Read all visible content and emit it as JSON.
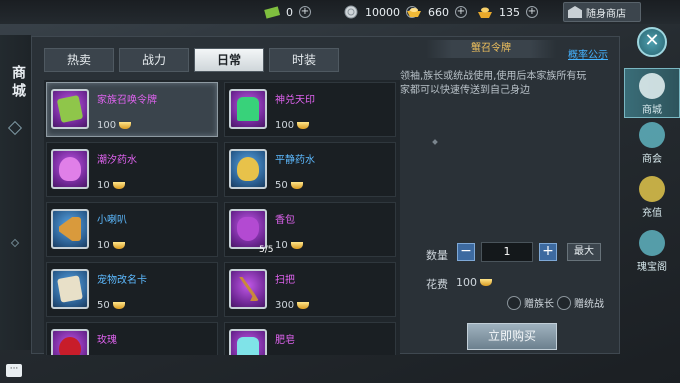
{
  "topbar": {
    "resources": [
      {
        "icon": "cash-icon",
        "value": "0"
      },
      {
        "icon": "silver-coin-icon",
        "value": "10000"
      },
      {
        "icon": "gold-ingot-icon",
        "value": "660"
      },
      {
        "icon": "bound-ingot-icon",
        "value": "135"
      }
    ],
    "shop_button": "随身商店"
  },
  "left_title": "商城",
  "tabs": [
    {
      "label": "热卖"
    },
    {
      "label": "战力"
    },
    {
      "label": "日常"
    },
    {
      "label": "时装"
    }
  ],
  "active_tab": "日常",
  "notice_link": "概率公示",
  "items": [
    {
      "name": "家族召唤令牌",
      "price": "100",
      "rarity": "purple",
      "icon": "summon-token-icon",
      "qty": "",
      "selected": true
    },
    {
      "name": "神兑天印",
      "price": "100",
      "rarity": "purple",
      "icon": "jade-seal-icon",
      "qty": ""
    },
    {
      "name": "潮汐药水",
      "price": "10",
      "rarity": "purple",
      "icon": "potion-bottle-icon",
      "qty": ""
    },
    {
      "name": "平静药水",
      "price": "50",
      "rarity": "blue",
      "icon": "potion-bottle-icon",
      "qty": ""
    },
    {
      "name": "小喇叭",
      "price": "10",
      "rarity": "blue",
      "icon": "horn-icon",
      "qty": ""
    },
    {
      "name": "香包",
      "price": "10",
      "rarity": "purple",
      "icon": "sachet-icon",
      "qty": "5/5"
    },
    {
      "name": "宠物改名卡",
      "price": "50",
      "rarity": "blue",
      "icon": "rename-card-icon",
      "qty": ""
    },
    {
      "name": "扫把",
      "price": "300",
      "rarity": "purple",
      "icon": "broom-icon",
      "qty": ""
    },
    {
      "name": "玫瑰",
      "price": "",
      "rarity": "purple",
      "icon": "rose-icon",
      "qty": ""
    },
    {
      "name": "肥皂",
      "price": "",
      "rarity": "purple",
      "icon": "soap-icon",
      "qty": ""
    }
  ],
  "detail": {
    "title": "蟹召令牌",
    "description": "领袖,族长或统战使用,使用后本家族所有玩家都可以快速传送到自己身边",
    "quantity_label": "数量",
    "quantity_value": "1",
    "max_label": "最大",
    "cost_label": "花费",
    "cost_value": "100",
    "gift_leader": "赠族长",
    "gift_commander": "赠统战",
    "buy_label": "立即购买"
  },
  "sidenav": [
    {
      "label": "商城",
      "icon": "shop-icon"
    },
    {
      "label": "商会",
      "icon": "guild-icon"
    },
    {
      "label": "充值",
      "icon": "recharge-icon"
    },
    {
      "label": "瑰宝阁",
      "icon": "treasure-icon"
    }
  ],
  "colors": {
    "purple_rarity": "#e063f0",
    "blue_rarity": "#5dbaff",
    "detail_title": "#f0c25e",
    "notice_link": "#45b3ff"
  }
}
